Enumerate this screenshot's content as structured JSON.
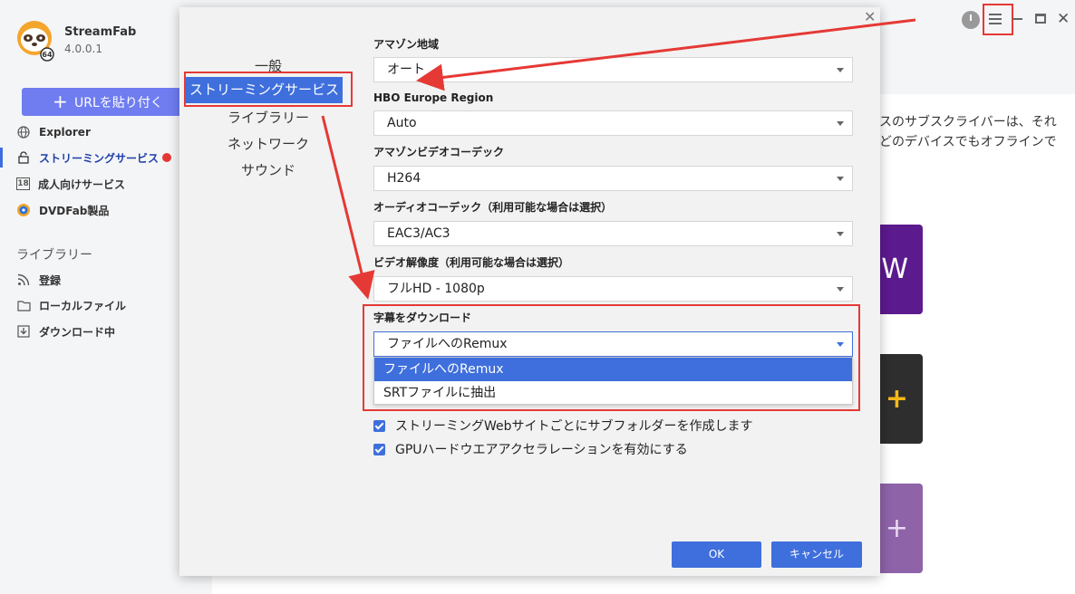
{
  "app": {
    "name": "StreamFab",
    "version": "4.0.0.1",
    "paste_button": "URLを貼り付く",
    "nav": [
      {
        "label": "Explorer",
        "icon": "globe-icon"
      },
      {
        "label": "ストリーミングサービス",
        "icon": "lock-icon"
      },
      {
        "label": "成人向けサービス",
        "icon": "age-18-icon"
      },
      {
        "label": "DVDFab製品",
        "icon": "dvdfab-icon"
      }
    ],
    "library_heading": "ライブラリー",
    "library_nav": [
      {
        "label": "登録",
        "icon": "rss-icon"
      },
      {
        "label": "ローカルファイル",
        "icon": "folder-icon"
      },
      {
        "label": "ダウンロード中",
        "icon": "download-icon"
      }
    ],
    "main_description_lines": [
      "スのサブスクライバーは、それ",
      "どのデバイスでもオフラインで"
    ],
    "tiles": [
      "W",
      "+",
      "+"
    ]
  },
  "dialog": {
    "categories": [
      "一般",
      "ストリーミングサービス",
      "ライブラリー",
      "ネットワーク",
      "サウンド"
    ],
    "fields": [
      {
        "label": "アマゾン地域",
        "value": "オート"
      },
      {
        "label": "HBO Europe Region",
        "value": "Auto"
      },
      {
        "label": "アマゾンビデオコーデック",
        "value": "H264"
      },
      {
        "label": "オーディオコーデック（利用可能な場合は選択）",
        "value": "EAC3/AC3"
      },
      {
        "label": "ビデオ解像度（利用可能な場合は選択）",
        "value": "フルHD - 1080p"
      },
      {
        "label": "字幕をダウンロード",
        "value": "ファイルへのRemux"
      }
    ],
    "subtitle_options": [
      "ファイルへのRemux",
      "SRTファイルに抽出"
    ],
    "checkboxes": [
      {
        "label": "ストリーミングWebサイトごとにサブフォルダーを作成します",
        "checked": true
      },
      {
        "label": "GPUハードウエアアクセラレーションを有効にする",
        "checked": true
      }
    ],
    "ok_label": "OK",
    "cancel_label": "キャンセル"
  },
  "colors": {
    "accent": "#3f6fdc",
    "annotation": "#e53935",
    "paste_button": "#6f7df1"
  }
}
